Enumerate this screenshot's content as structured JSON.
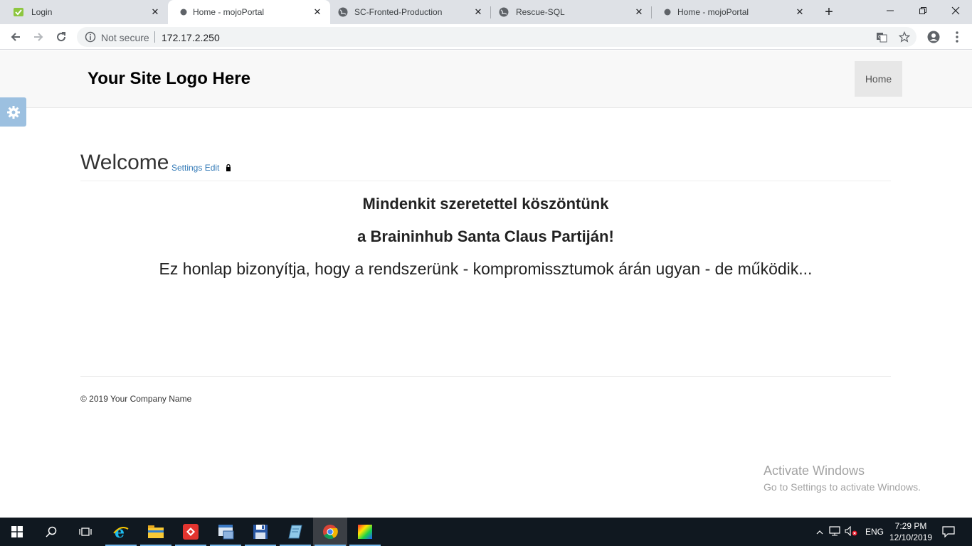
{
  "browser": {
    "tabs": [
      {
        "title": "Login",
        "icon": "login-favicon-icon",
        "active": false
      },
      {
        "title": "Home - mojoPortal",
        "icon": "globe-icon",
        "active": true
      },
      {
        "title": "SC-Fronted-Production",
        "icon": "globe-icon",
        "active": false
      },
      {
        "title": "Rescue-SQL",
        "icon": "globe-icon",
        "active": false
      },
      {
        "title": "Home - mojoPortal",
        "icon": "globe-icon",
        "active": false
      }
    ],
    "security_status": "Not secure",
    "url": "172.17.2.250"
  },
  "site": {
    "logo": "Your Site Logo Here",
    "nav_home": "Home",
    "welcome_title": "Welcome",
    "welcome_links": "Settings Edit",
    "content_line1": "Mindenkit szeretettel köszöntünk",
    "content_line2": "a Braininhub Santa Claus Partiján!",
    "content_line3": "Ez honlap bizonyítja, hogy a rendszerünk - kompromissztumok árán ugyan - de működik...",
    "footer": "© 2019 Your Company Name"
  },
  "watermark": {
    "title": "Activate Windows",
    "subtitle": "Go to Settings to activate Windows."
  },
  "taskbar": {
    "language": "ENG",
    "time": "7:29 PM",
    "date": "12/10/2019"
  },
  "colors": {
    "link": "#337ab7",
    "gear_tab": "#9cc0e0",
    "taskbar": "#101820",
    "taskbar_accent": "#76b9ed"
  }
}
